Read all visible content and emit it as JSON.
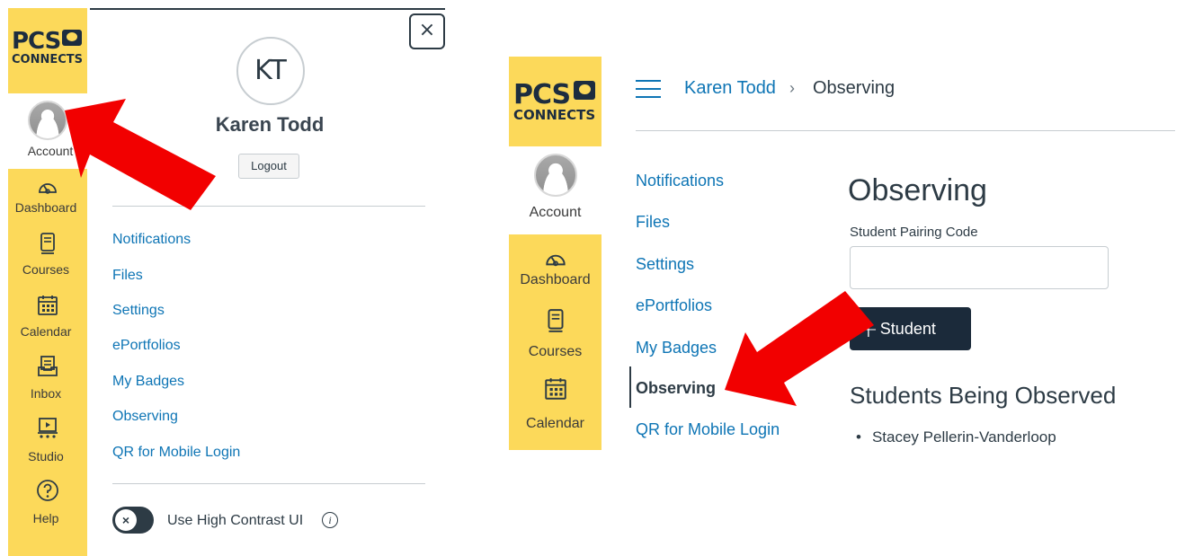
{
  "left_panel": {
    "logo": {
      "line1": "PCS",
      "line2": "CONNECTS"
    },
    "nav": [
      {
        "label": "Account",
        "icon": "account-avatar-icon"
      },
      {
        "label": "Dashboard",
        "icon": "dashboard-gauge-icon"
      },
      {
        "label": "Courses",
        "icon": "courses-book-icon"
      },
      {
        "label": "Calendar",
        "icon": "calendar-icon"
      },
      {
        "label": "Inbox",
        "icon": "inbox-icon"
      },
      {
        "label": "Studio",
        "icon": "studio-icon"
      },
      {
        "label": "Help",
        "icon": "help-icon"
      }
    ],
    "tray": {
      "close_glyph": "×",
      "initials": "KT",
      "name": "Karen Todd",
      "logout_label": "Logout",
      "links": [
        "Notifications",
        "Files",
        "Settings",
        "ePortfolios",
        "My Badges",
        "Observing",
        "QR for Mobile Login"
      ],
      "toggle_glyph": "×",
      "high_contrast_label": "Use High Contrast UI",
      "info_glyph": "i"
    }
  },
  "right_panel": {
    "logo": {
      "line1": "PCS",
      "line2": "CONNECTS"
    },
    "nav": [
      {
        "label": "Account",
        "icon": "account-avatar-icon"
      },
      {
        "label": "Dashboard",
        "icon": "dashboard-gauge-icon"
      },
      {
        "label": "Courses",
        "icon": "courses-book-icon"
      },
      {
        "label": "Calendar",
        "icon": "calendar-icon"
      }
    ],
    "breadcrumb": {
      "user": "Karen Todd",
      "separator": "›",
      "current": "Observing"
    },
    "links": [
      "Notifications",
      "Files",
      "Settings",
      "ePortfolios",
      "My Badges",
      "Observing",
      "QR for Mobile Login"
    ],
    "active_link": "Observing",
    "page": {
      "title": "Observing",
      "pairing_label": "Student Pairing Code",
      "pairing_value": "",
      "add_button_plus": "+",
      "add_button_label": "Student",
      "students_heading": "Students Being Observed",
      "students": [
        "Stacey Pellerin-Vanderloop"
      ]
    }
  },
  "colors": {
    "brand_yellow": "#fcd95a",
    "link_blue": "#0e75b5",
    "text_dark": "#2d3b45",
    "button_navy": "#1b2a3a",
    "arrow_red": "#f20000"
  }
}
